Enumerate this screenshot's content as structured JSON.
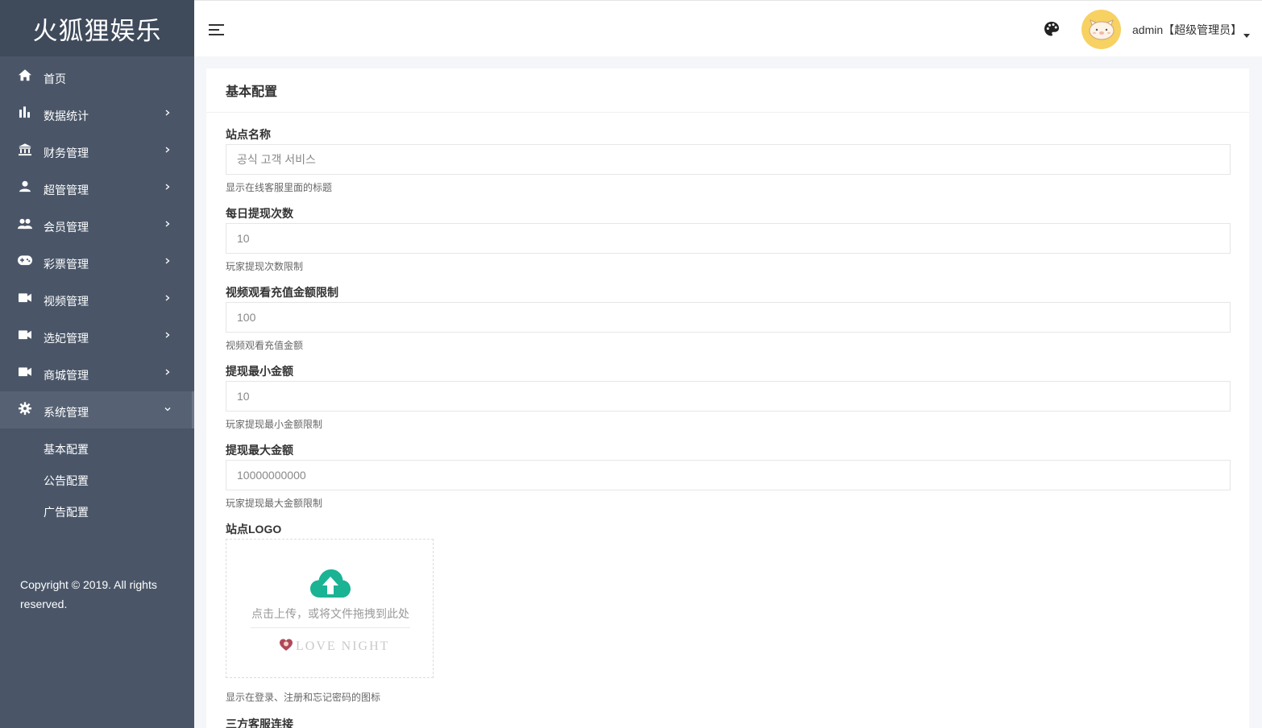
{
  "brand": {
    "title": "火狐狸娱乐"
  },
  "sidebar": {
    "items": [
      {
        "label": "首页",
        "icon": "home-icon",
        "has_arrow": false
      },
      {
        "label": "数据统计",
        "icon": "bar-chart-icon",
        "has_arrow": true
      },
      {
        "label": "财务管理",
        "icon": "bank-icon",
        "has_arrow": true
      },
      {
        "label": "超管管理",
        "icon": "user-icon",
        "has_arrow": true
      },
      {
        "label": "会员管理",
        "icon": "users-icon",
        "has_arrow": true
      },
      {
        "label": "彩票管理",
        "icon": "gamepad-icon",
        "has_arrow": true
      },
      {
        "label": "视频管理",
        "icon": "video-icon",
        "has_arrow": true
      },
      {
        "label": "选妃管理",
        "icon": "video-icon",
        "has_arrow": true
      },
      {
        "label": "商城管理",
        "icon": "video-icon",
        "has_arrow": true
      },
      {
        "label": "系统管理",
        "icon": "gear-icon",
        "has_arrow": true,
        "expanded": true
      }
    ],
    "subitems": [
      {
        "label": "基本配置"
      },
      {
        "label": "公告配置"
      },
      {
        "label": "广告配置"
      }
    ],
    "copyright": "Copyright © 2019. All rights reserved."
  },
  "header": {
    "user_label": "admin【超级管理员】"
  },
  "main": {
    "card_title": "基本配置",
    "fields": [
      {
        "label": "站点名称",
        "value": "공식 고객 서비스",
        "help": "显示在线客服里面的标题"
      },
      {
        "label": "每日提现次数",
        "value": "10",
        "help": "玩家提现次数限制"
      },
      {
        "label": "视频观看充值金额限制",
        "value": "100",
        "help": "视频观看充值金额"
      },
      {
        "label": "提现最小金额",
        "value": "10",
        "help": "玩家提现最小金额限制"
      },
      {
        "label": "提现最大金额",
        "value": "10000000000",
        "help": "玩家提现最大金额限制"
      }
    ],
    "logo_field": {
      "label": "站点LOGO",
      "upload_text": "点击上传，或将文件拖拽到此处",
      "logo_text": "LOVE NIGHT",
      "help": "显示在登录、注册和忘记密码的图标"
    },
    "next_label": "三方客服连接"
  },
  "colors": {
    "sidebar_bg": "#4a5668",
    "brand_bg": "#3f4a5b",
    "accent": "#1ab394"
  }
}
